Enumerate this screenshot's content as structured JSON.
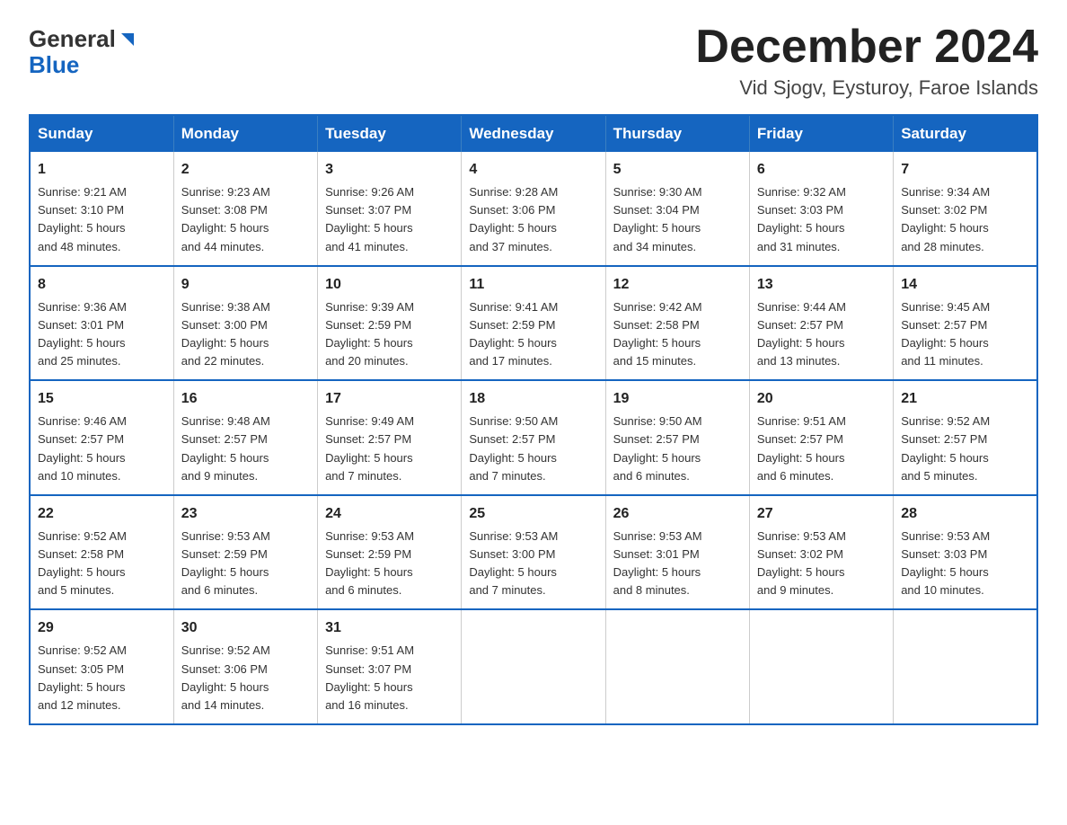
{
  "header": {
    "logo_line1": "General",
    "logo_line2": "Blue",
    "month_title": "December 2024",
    "location": "Vid Sjogv, Eysturoy, Faroe Islands"
  },
  "days_of_week": [
    "Sunday",
    "Monday",
    "Tuesday",
    "Wednesday",
    "Thursday",
    "Friday",
    "Saturday"
  ],
  "weeks": [
    [
      {
        "day": "1",
        "info": "Sunrise: 9:21 AM\nSunset: 3:10 PM\nDaylight: 5 hours\nand 48 minutes."
      },
      {
        "day": "2",
        "info": "Sunrise: 9:23 AM\nSunset: 3:08 PM\nDaylight: 5 hours\nand 44 minutes."
      },
      {
        "day": "3",
        "info": "Sunrise: 9:26 AM\nSunset: 3:07 PM\nDaylight: 5 hours\nand 41 minutes."
      },
      {
        "day": "4",
        "info": "Sunrise: 9:28 AM\nSunset: 3:06 PM\nDaylight: 5 hours\nand 37 minutes."
      },
      {
        "day": "5",
        "info": "Sunrise: 9:30 AM\nSunset: 3:04 PM\nDaylight: 5 hours\nand 34 minutes."
      },
      {
        "day": "6",
        "info": "Sunrise: 9:32 AM\nSunset: 3:03 PM\nDaylight: 5 hours\nand 31 minutes."
      },
      {
        "day": "7",
        "info": "Sunrise: 9:34 AM\nSunset: 3:02 PM\nDaylight: 5 hours\nand 28 minutes."
      }
    ],
    [
      {
        "day": "8",
        "info": "Sunrise: 9:36 AM\nSunset: 3:01 PM\nDaylight: 5 hours\nand 25 minutes."
      },
      {
        "day": "9",
        "info": "Sunrise: 9:38 AM\nSunset: 3:00 PM\nDaylight: 5 hours\nand 22 minutes."
      },
      {
        "day": "10",
        "info": "Sunrise: 9:39 AM\nSunset: 2:59 PM\nDaylight: 5 hours\nand 20 minutes."
      },
      {
        "day": "11",
        "info": "Sunrise: 9:41 AM\nSunset: 2:59 PM\nDaylight: 5 hours\nand 17 minutes."
      },
      {
        "day": "12",
        "info": "Sunrise: 9:42 AM\nSunset: 2:58 PM\nDaylight: 5 hours\nand 15 minutes."
      },
      {
        "day": "13",
        "info": "Sunrise: 9:44 AM\nSunset: 2:57 PM\nDaylight: 5 hours\nand 13 minutes."
      },
      {
        "day": "14",
        "info": "Sunrise: 9:45 AM\nSunset: 2:57 PM\nDaylight: 5 hours\nand 11 minutes."
      }
    ],
    [
      {
        "day": "15",
        "info": "Sunrise: 9:46 AM\nSunset: 2:57 PM\nDaylight: 5 hours\nand 10 minutes."
      },
      {
        "day": "16",
        "info": "Sunrise: 9:48 AM\nSunset: 2:57 PM\nDaylight: 5 hours\nand 9 minutes."
      },
      {
        "day": "17",
        "info": "Sunrise: 9:49 AM\nSunset: 2:57 PM\nDaylight: 5 hours\nand 7 minutes."
      },
      {
        "day": "18",
        "info": "Sunrise: 9:50 AM\nSunset: 2:57 PM\nDaylight: 5 hours\nand 7 minutes."
      },
      {
        "day": "19",
        "info": "Sunrise: 9:50 AM\nSunset: 2:57 PM\nDaylight: 5 hours\nand 6 minutes."
      },
      {
        "day": "20",
        "info": "Sunrise: 9:51 AM\nSunset: 2:57 PM\nDaylight: 5 hours\nand 6 minutes."
      },
      {
        "day": "21",
        "info": "Sunrise: 9:52 AM\nSunset: 2:57 PM\nDaylight: 5 hours\nand 5 minutes."
      }
    ],
    [
      {
        "day": "22",
        "info": "Sunrise: 9:52 AM\nSunset: 2:58 PM\nDaylight: 5 hours\nand 5 minutes."
      },
      {
        "day": "23",
        "info": "Sunrise: 9:53 AM\nSunset: 2:59 PM\nDaylight: 5 hours\nand 6 minutes."
      },
      {
        "day": "24",
        "info": "Sunrise: 9:53 AM\nSunset: 2:59 PM\nDaylight: 5 hours\nand 6 minutes."
      },
      {
        "day": "25",
        "info": "Sunrise: 9:53 AM\nSunset: 3:00 PM\nDaylight: 5 hours\nand 7 minutes."
      },
      {
        "day": "26",
        "info": "Sunrise: 9:53 AM\nSunset: 3:01 PM\nDaylight: 5 hours\nand 8 minutes."
      },
      {
        "day": "27",
        "info": "Sunrise: 9:53 AM\nSunset: 3:02 PM\nDaylight: 5 hours\nand 9 minutes."
      },
      {
        "day": "28",
        "info": "Sunrise: 9:53 AM\nSunset: 3:03 PM\nDaylight: 5 hours\nand 10 minutes."
      }
    ],
    [
      {
        "day": "29",
        "info": "Sunrise: 9:52 AM\nSunset: 3:05 PM\nDaylight: 5 hours\nand 12 minutes."
      },
      {
        "day": "30",
        "info": "Sunrise: 9:52 AM\nSunset: 3:06 PM\nDaylight: 5 hours\nand 14 minutes."
      },
      {
        "day": "31",
        "info": "Sunrise: 9:51 AM\nSunset: 3:07 PM\nDaylight: 5 hours\nand 16 minutes."
      },
      {
        "day": "",
        "info": ""
      },
      {
        "day": "",
        "info": ""
      },
      {
        "day": "",
        "info": ""
      },
      {
        "day": "",
        "info": ""
      }
    ]
  ]
}
